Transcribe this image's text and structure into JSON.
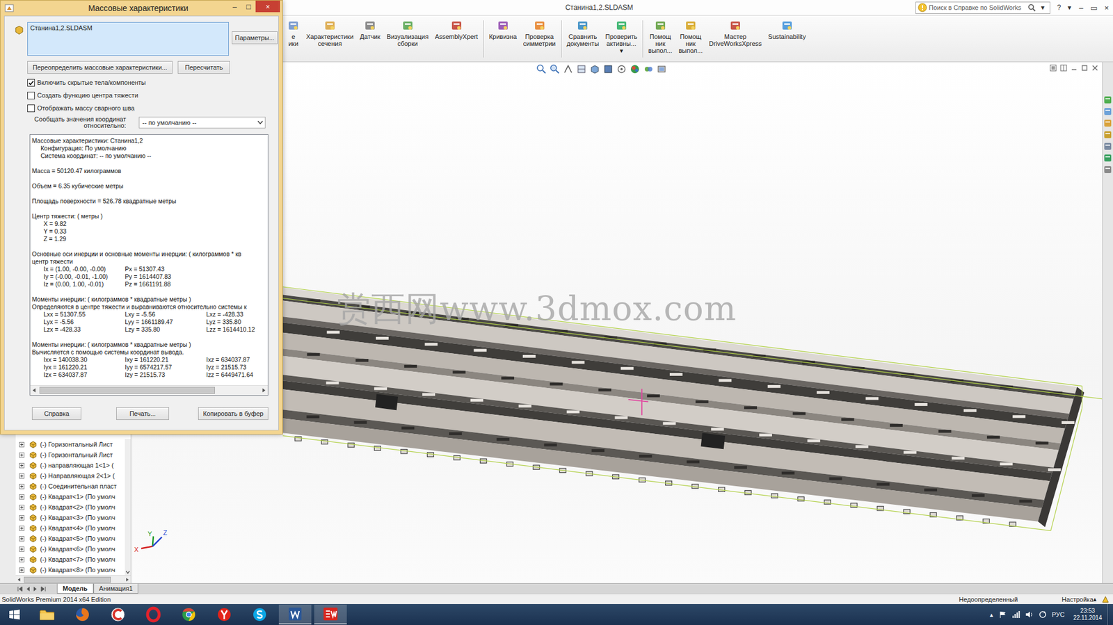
{
  "window": {
    "title": "Станина1,2.SLDASM",
    "controls": [
      "–",
      "▭",
      "×"
    ]
  },
  "search": {
    "placeholder": "Поиск в Справке по SolidWorks",
    "arrow": "▾"
  },
  "help": {
    "label": "?",
    "arrow": "▾"
  },
  "ribbon": [
    {
      "lines": [
        "е",
        "ики"
      ],
      "separator": false
    },
    {
      "lines": [
        "Характеристики",
        "сечения"
      ],
      "separator": false
    },
    {
      "lines": [
        "Датчик"
      ],
      "separator": false
    },
    {
      "lines": [
        "Визуализация",
        "сборки"
      ],
      "separator": false
    },
    {
      "lines": [
        "AssemblyXpert"
      ],
      "separator": true
    },
    {
      "lines": [
        "Кривизна"
      ],
      "separator": false
    },
    {
      "lines": [
        "Проверка",
        "симметрии"
      ],
      "separator": true
    },
    {
      "lines": [
        "Сравнить",
        "документы"
      ],
      "separator": false
    },
    {
      "lines": [
        "Проверить",
        "активны...",
        "▾"
      ],
      "separator": true
    },
    {
      "lines": [
        "Помощ",
        "ник",
        "выпол..."
      ],
      "separator": false
    },
    {
      "lines": [
        "Помощ",
        "ник",
        "выпол..."
      ],
      "separator": false
    },
    {
      "lines": [
        "Мастер",
        "DriveWorksXpress"
      ],
      "separator": false
    },
    {
      "lines": [
        "Sustainability"
      ],
      "separator": false
    }
  ],
  "watermark": "赏西网www.3dmox.com",
  "triad": [
    "X",
    "Y",
    "Z"
  ],
  "dialog": {
    "title": "Массовые характеристики",
    "controls": [
      "–",
      "□",
      "×"
    ],
    "selection": "Станина1,2.SLDASM",
    "options_button": "Параметры...",
    "override_button": "Переопределить массовые характеристики...",
    "recalc_button": "Пересчитать",
    "checkboxes": [
      {
        "label": "Включить скрытые тела/компоненты",
        "checked": true
      },
      {
        "label": "Создать функцию центра тяжести",
        "checked": false
      },
      {
        "label": "Отображать массу сварного шва",
        "checked": false
      }
    ],
    "coord_label": [
      "Сообщать значения координат",
      "относительно:"
    ],
    "coord_value": "-- по умолчанию --",
    "report": [
      {
        "kind": "heading",
        "text": "Массовые характеристики: Станина1,2"
      },
      {
        "kind": "sub",
        "text": "Конфигурация: По умолчанию"
      },
      {
        "kind": "sub",
        "text": "Система координат: -- по умолчанию --"
      },
      {
        "kind": "blank"
      },
      {
        "kind": "heading",
        "text": "Масса = 50120.47 килограммов"
      },
      {
        "kind": "blank"
      },
      {
        "kind": "heading",
        "text": "Объем = 6.35 кубические метры"
      },
      {
        "kind": "blank"
      },
      {
        "kind": "heading",
        "text": "Площадь поверхности = 526.78 квадратные метры"
      },
      {
        "kind": "blank"
      },
      {
        "kind": "heading",
        "text": "Центр тяжести: ( метры )"
      },
      {
        "kind": "value",
        "text": "X = 9.82"
      },
      {
        "kind": "value",
        "text": "Y = 0.33"
      },
      {
        "kind": "value",
        "text": "Z = 1.29"
      },
      {
        "kind": "blank"
      },
      {
        "kind": "heading",
        "text": "Основные оси инерции и основные моменты инерции: ( килограммов * кв"
      },
      {
        "kind": "heading",
        "text": "центр тяжести"
      },
      {
        "kind": "grid",
        "cells": [
          "Ix = (1.00, -0.00, -0.00)",
          "Px = 51307.43"
        ]
      },
      {
        "kind": "grid",
        "cells": [
          "Iy = (-0.00, -0.01, -1.00)",
          "Py = 1614407.83"
        ]
      },
      {
        "kind": "grid",
        "cells": [
          "Iz = (0.00, 1.00, -0.01)",
          "Pz = 1661191.88"
        ]
      },
      {
        "kind": "blank"
      },
      {
        "kind": "heading",
        "text": "Моменты инерции: ( килограммов * квадратные метры )"
      },
      {
        "kind": "heading",
        "text": "Определяются в центре тяжести и выравниваются относительно системы к"
      },
      {
        "kind": "grid",
        "cells": [
          "Lxx = 51307.55",
          "Lxy = -5.56",
          "Lxz = -428.33"
        ]
      },
      {
        "kind": "grid",
        "cells": [
          "Lyx = -5.56",
          "Lyy = 1661189.47",
          "Lyz = 335.80"
        ]
      },
      {
        "kind": "grid",
        "cells": [
          "Lzx = -428.33",
          "Lzy = 335.80",
          "Lzz = 1614410.12"
        ]
      },
      {
        "kind": "blank"
      },
      {
        "kind": "heading",
        "text": "Моменты инерции: ( килограммов * квадратные метры )"
      },
      {
        "kind": "heading",
        "text": "Вычисляется с помощью системы координат вывода."
      },
      {
        "kind": "grid",
        "cells": [
          "Ixx = 140038.30",
          "Ixy = 161220.21",
          "Ixz = 634037.87"
        ]
      },
      {
        "kind": "grid",
        "cells": [
          "Iyx = 161220.21",
          "Iyy = 6574217.57",
          "Iyz = 21515.73"
        ]
      },
      {
        "kind": "grid",
        "cells": [
          "Izx = 634037.87",
          "Izy = 21515.73",
          "Izz = 6449471.64"
        ]
      }
    ],
    "hscroll": {
      "level": 0.8
    },
    "buttons": [
      "Справка",
      "Печать...",
      "Копировать в буфер"
    ]
  },
  "tree": {
    "items": [
      {
        "label": "(-) Горизонтальный Лист",
        "expanded": false
      },
      {
        "label": "(-) Горизонтальный Лист",
        "expanded": false
      },
      {
        "label": "(-) направляющая 1<1> (",
        "expanded": false
      },
      {
        "label": "(-) Направляющая 2<1> (",
        "expanded": false
      },
      {
        "label": "(-) Соединительная пласт",
        "expanded": false
      },
      {
        "label": "(-) Квадрат<1> (По умолч",
        "expanded": false
      },
      {
        "label": "(-) Квадрат<2> (По умолч",
        "expanded": false
      },
      {
        "label": "(-) Квадрат<3> (По умолч",
        "expanded": false
      },
      {
        "label": "(-) Квадрат<4> (По умолч",
        "expanded": false
      },
      {
        "label": "(-) Квадрат<5> (По умолч",
        "expanded": false
      },
      {
        "label": "(-) Квадрат<6> (По умолч",
        "expanded": false
      },
      {
        "label": "(-) Квадрат<7> (По умолч",
        "expanded": false
      },
      {
        "label": "(-) Квадрат<8> (По умолч",
        "expanded": false
      }
    ],
    "hscroll": {
      "level": 0.88
    }
  },
  "bottom_tabs": [
    {
      "label": "Модель",
      "selected": true
    },
    {
      "label": "Анимация1",
      "selected": false
    }
  ],
  "status_bar": {
    "product": "SolidWorks Premium 2014 x64 Edition",
    "state": "Недоопределенный",
    "units": "Настройка",
    "arrow": "▴"
  },
  "taskbar": {
    "apps": [
      {
        "kind": "explorer",
        "running": false
      },
      {
        "kind": "firefox",
        "running": false
      },
      {
        "kind": "ccleaner",
        "running": false
      },
      {
        "kind": "opera",
        "running": false
      },
      {
        "kind": "chrome",
        "running": false
      },
      {
        "kind": "yandex",
        "running": false
      },
      {
        "kind": "skype",
        "running": false
      },
      {
        "kind": "word",
        "running": true
      },
      {
        "kind": "solidworks",
        "running": true
      }
    ],
    "tray": {
      "arrow": "▴",
      "language": "РУС",
      "time": "23:53",
      "date": "22.11.2014"
    }
  }
}
